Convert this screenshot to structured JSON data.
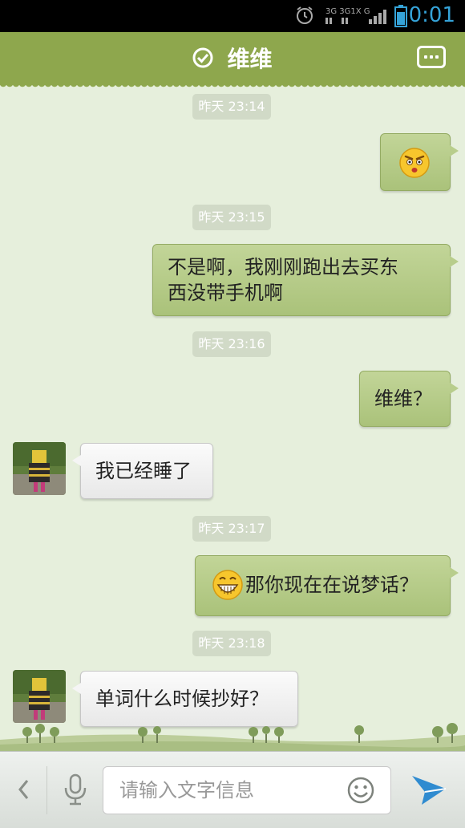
{
  "status_bar": {
    "time": "0:01",
    "network": "3G 3G 1X G"
  },
  "header": {
    "title": "维维"
  },
  "messages": [
    {
      "type": "timestamp",
      "text": "昨天 23:14"
    },
    {
      "type": "outgoing",
      "kind": "emoji",
      "emoji": "angry-face-icon"
    },
    {
      "type": "timestamp",
      "text": "昨天 23:15"
    },
    {
      "type": "outgoing",
      "kind": "text",
      "lines": [
        "不是啊，我刚刚跑出去买东",
        "西没带手机啊"
      ]
    },
    {
      "type": "timestamp",
      "text": "昨天 23:16"
    },
    {
      "type": "outgoing",
      "kind": "text",
      "text": "维维？"
    },
    {
      "type": "incoming",
      "kind": "text",
      "text": "我已经睡了"
    },
    {
      "type": "timestamp",
      "text": "昨天 23:17"
    },
    {
      "type": "outgoing",
      "kind": "text",
      "emoji": "grin-face-icon",
      "text": "那你现在在说梦话？"
    },
    {
      "type": "timestamp",
      "text": "昨天 23:18"
    },
    {
      "type": "incoming",
      "kind": "text",
      "text": "单词什么时候抄好？"
    }
  ],
  "input_bar": {
    "placeholder": "请输入文字信息"
  },
  "colors": {
    "header": "#8ea74d",
    "background": "#e6efdc",
    "outgoing_bubble": "#b8cd8c",
    "incoming_bubble": "#f5f5f5",
    "status_time": "#35a3d8"
  }
}
